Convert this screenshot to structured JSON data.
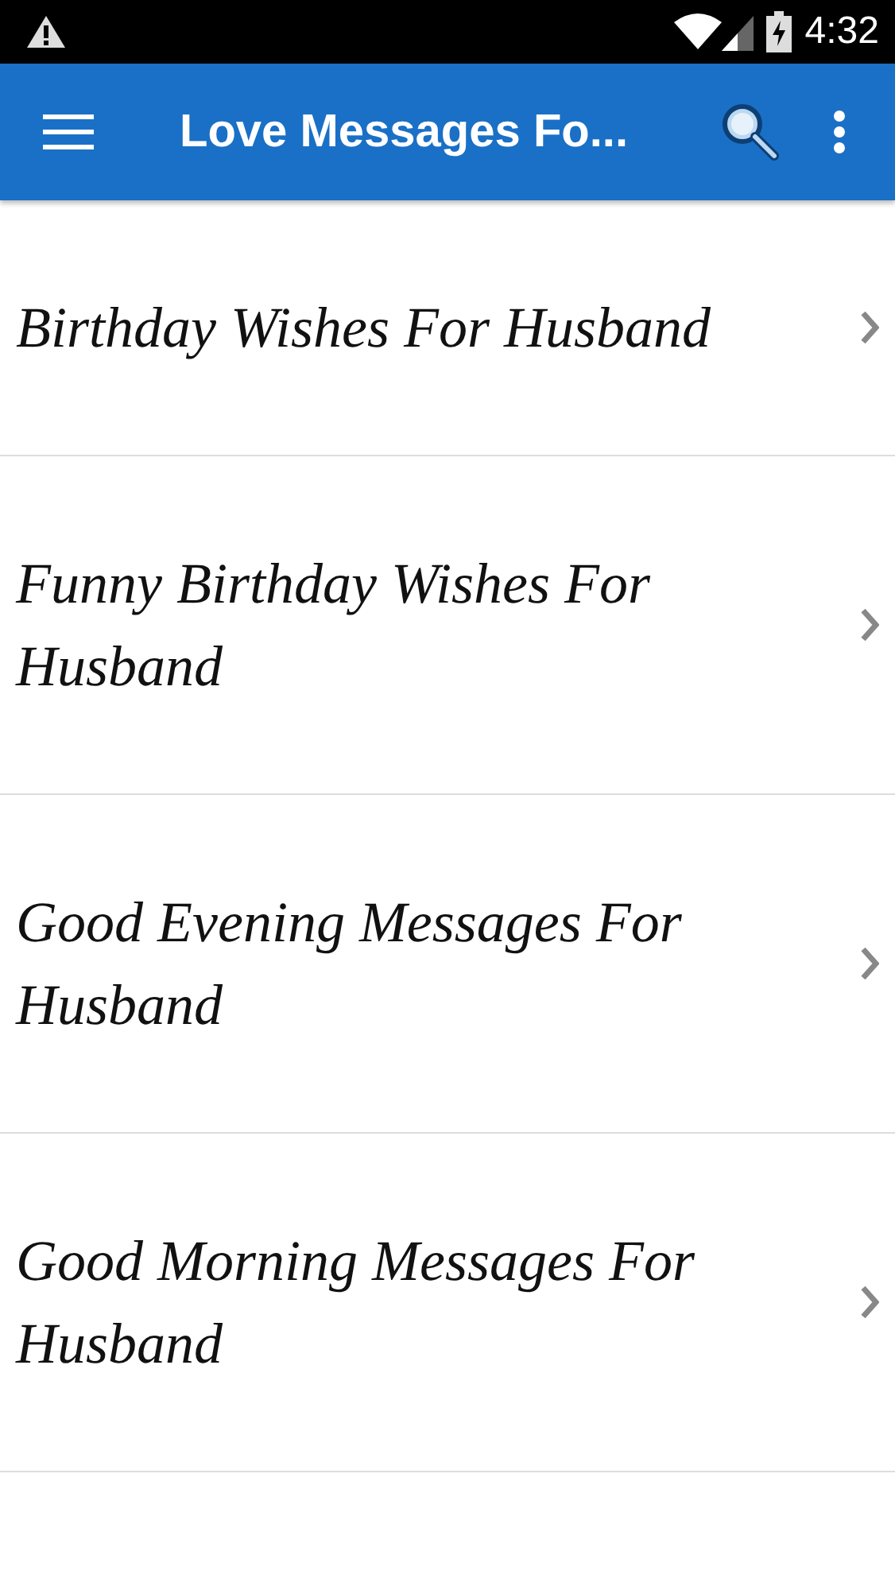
{
  "status_bar": {
    "time": "4:32"
  },
  "app_bar": {
    "title": "Love Messages Fo..."
  },
  "items": [
    {
      "label": "Birthday Wishes For Husband"
    },
    {
      "label": "Funny Birthday Wishes For Husband"
    },
    {
      "label": "Good Evening Messages For Husband"
    },
    {
      "label": "Good Morning Messages For Husband"
    }
  ]
}
